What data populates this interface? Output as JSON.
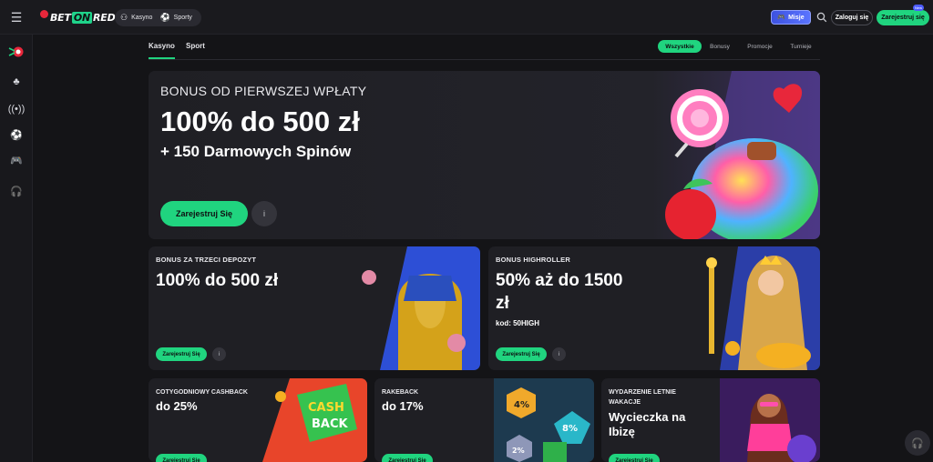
{
  "header": {
    "menu_icon": "hamburger-icon",
    "logo": {
      "part1": "BET",
      "part2": "ON",
      "part3": "RED"
    },
    "switch": {
      "casino": "Kasyno",
      "sports": "Sporty"
    },
    "missions": "Misje",
    "login": "Zaloguj się",
    "register": "Zarejestruj się",
    "new_badge": "New"
  },
  "sidebar": {
    "icons": [
      "casino-icon",
      "cherry-icon",
      "live-icon",
      "football-icon",
      "gamepad-icon",
      "support-headset-icon"
    ]
  },
  "tabs": {
    "items": [
      "Kasyno",
      "Sport"
    ],
    "active": "Kasyno",
    "filters": [
      "Wszystkie",
      "Bonusy",
      "Promocje",
      "Turnieje"
    ],
    "active_filter": "Wszystkie"
  },
  "hero": {
    "kicker": "BONUS OD PIERWSZEJ WPŁATY",
    "title": "100% do 500 zł",
    "subtitle": "+ 150 Darmowych Spinów",
    "button": "Zarejestruj Się",
    "info": "i"
  },
  "cards": [
    {
      "kicker": "BONUS ZA TRZECI DEPOZYT",
      "title": "100% do 500 zł",
      "button": "Zarejestruj Się",
      "info": "i"
    },
    {
      "kicker": "BONUS HIGHROLLER",
      "title_line1": "50% aż do 1500",
      "title_line2": "zł",
      "code": "kod: 50HIGH",
      "button": "Zarejestruj Się",
      "info": "i"
    }
  ],
  "small_cards": [
    {
      "kicker": "COTYGODNIOWY CASHBACK",
      "title": "do 25%",
      "button": "Zarejestruj Się",
      "art_text": [
        "CASH",
        "BACK"
      ]
    },
    {
      "kicker": "RAKEBACK",
      "title": "do 17%",
      "button": "Zarejestruj Się",
      "art_badges": [
        "4%",
        "8%",
        "2%"
      ]
    },
    {
      "kicker_line1": "WYDARZENIE LETNIE",
      "kicker_line2": "WAKACJE",
      "title_line1": "Wycieczka na",
      "title_line2": "Ibizę",
      "button": "Zarejestruj Się"
    }
  ],
  "colors": {
    "accent": "#20d47f",
    "background": "#141417",
    "card": "#1f1f24",
    "missions": "#4d5cff"
  }
}
